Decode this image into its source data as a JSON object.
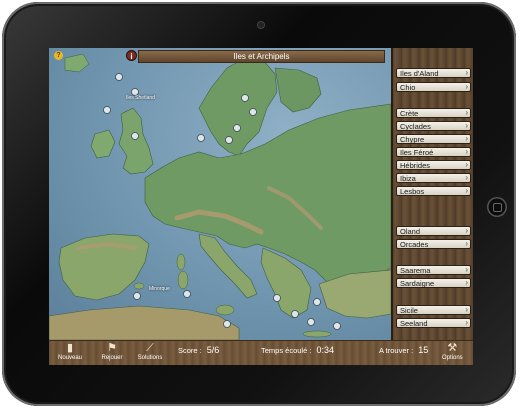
{
  "game": {
    "title": "Iles et Archipels",
    "info_icon": "i",
    "help_icon": "?"
  },
  "map_labels": {
    "iles_shetland": "Iles Shetland",
    "minorque": "Minorque"
  },
  "answer_list": [
    "Iles d'Aland",
    "Chio",
    "Crète",
    "Cyclades",
    "Chypre",
    "Iles Féroé",
    "Hébrides",
    "Ibiza",
    "Lesbos",
    "Oland",
    "Orcades",
    "Saarema",
    "Sardaigne",
    "Sicile",
    "Seeland"
  ],
  "toolbar": {
    "nouveau": "Nouveau",
    "rejouer": "Rejouer",
    "solutions": "Solutions",
    "options": "Options",
    "score_label": "Score :",
    "score_value": "5/6",
    "time_label": "Temps écoulé :",
    "time_value": "0:34",
    "remaining_label": "A trouver :",
    "remaining_value": "15"
  },
  "colors": {
    "wood": "#6b5238",
    "sea": "#6e93ad",
    "land": "#5f8f5a",
    "mountains": "#b49a70",
    "info_button": "#7a2b22",
    "help_button": "#e8b828"
  }
}
